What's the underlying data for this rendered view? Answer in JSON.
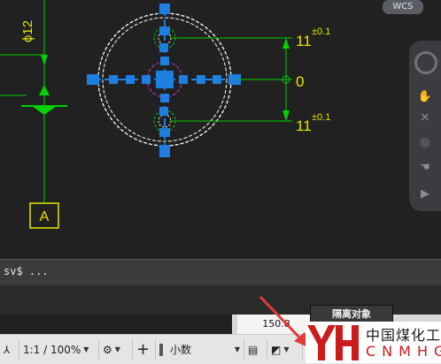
{
  "viewport": {
    "dim_diameter": "ϕ12",
    "dim_top": "11",
    "dim_top_tol": "±0.1",
    "dim_mid": "0",
    "dim_bot": "11",
    "dim_bot_tol": "±0.1",
    "section_label": "A",
    "wcs_label": "WCS"
  },
  "colors": {
    "background": "#212121",
    "green": "#00d100",
    "yellow": "#e6e600",
    "blue_grip": "#1f7fe0",
    "magenta": "#d22fd2",
    "white": "#ffffff"
  },
  "command_line": {
    "text": "sv$ ..."
  },
  "coordinates": {
    "value": "150.8"
  },
  "tooltip": {
    "label": "隔离对象"
  },
  "statusbar": {
    "scale": "1:1 / 100%",
    "units": "小数"
  },
  "watermark": {
    "logo_text": "YH",
    "cn": "中国煤化工",
    "en": "CNMHG"
  }
}
